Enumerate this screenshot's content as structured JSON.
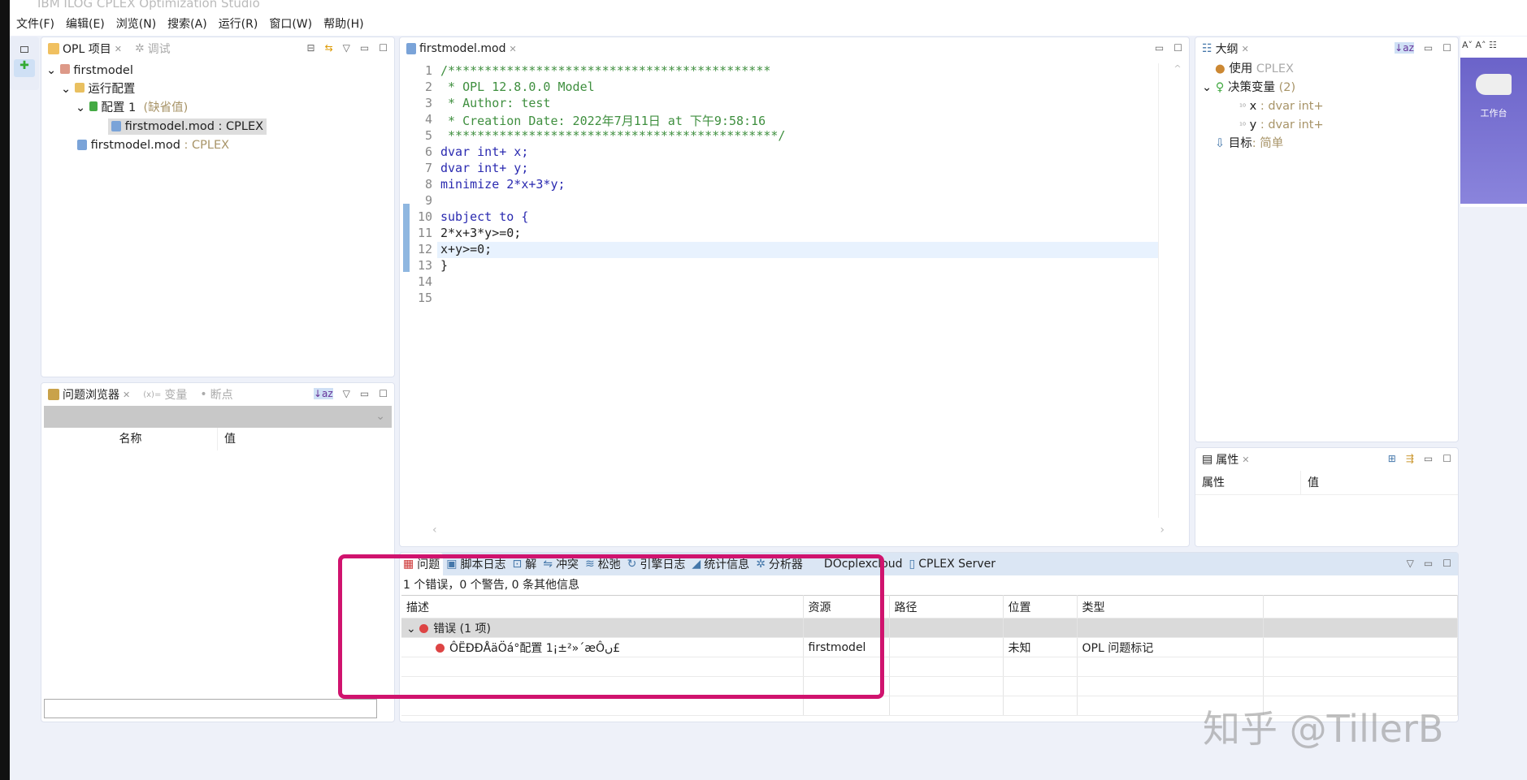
{
  "window": {
    "title": "IBM ILOG CPLEX Optimization Studio"
  },
  "menu": [
    "文件(F)",
    "编辑(E)",
    "浏览(N)",
    "搜索(A)",
    "运行(R)",
    "窗口(W)",
    "帮助(H)"
  ],
  "project_panel": {
    "tabs": [
      "OPL 项目",
      "调试"
    ],
    "tree": {
      "project": "firstmodel",
      "run_configs": "运行配置",
      "config": "配置 1",
      "config_default": "(缺省值)",
      "config_model": "firstmodel.mod : CPLEX",
      "model_name": "firstmodel.mod",
      "model_engine": ": CPLEX"
    }
  },
  "browser_panel": {
    "tabs": [
      "问题浏览器",
      "变量",
      "断点"
    ],
    "columns": [
      "名称",
      "值"
    ]
  },
  "editor": {
    "tab": "firstmodel.mod",
    "lines": [
      {
        "n": "1",
        "t": "/********************************************",
        "c": "cm"
      },
      {
        "n": "2",
        "t": " * OPL 12.8.0.0 Model",
        "c": "cm"
      },
      {
        "n": "3",
        "t": " * Author: test",
        "c": "cm"
      },
      {
        "n": "4",
        "t": " * Creation Date: 2022年7月11日 at 下午9:58:16",
        "c": "cm"
      },
      {
        "n": "5",
        "t": " *********************************************/",
        "c": "cm"
      },
      {
        "n": "6",
        "t": "dvar int+ x;",
        "c": "kw"
      },
      {
        "n": "7",
        "t": "dvar int+ y;",
        "c": "kw"
      },
      {
        "n": "8",
        "t": "minimize 2*x+3*y;",
        "c": "kw"
      },
      {
        "n": "9",
        "t": "",
        "c": ""
      },
      {
        "n": "10",
        "t": "subject to {",
        "c": "kw"
      },
      {
        "n": "11",
        "t": "2*x+3*y>=0;",
        "c": ""
      },
      {
        "n": "12",
        "t": "x+y>=0;",
        "c": ""
      },
      {
        "n": "13",
        "t": "}",
        "c": ""
      },
      {
        "n": "14",
        "t": "",
        "c": ""
      },
      {
        "n": "15",
        "t": "",
        "c": ""
      }
    ]
  },
  "outline": {
    "tab": "大纲",
    "use": "使用",
    "use_val": "CPLEX",
    "vars": "决策变量",
    "vars_count": "(2)",
    "x": "x",
    "x_type": ": dvar int+",
    "y": "y",
    "y_type": ": dvar int+",
    "goal": "目标",
    "goal_val": ": 简单"
  },
  "properties": {
    "tab": "属性",
    "columns": [
      "属性",
      "值"
    ]
  },
  "welcome": {
    "label": "工作台"
  },
  "problems": {
    "tabs": [
      "问题",
      "脚本日志",
      "解",
      "冲突",
      "松弛",
      "引擎日志",
      "统计信息",
      "分析器",
      "DOcplexcloud",
      "CPLEX Server"
    ],
    "summary": "1 个错误，0 个警告, 0 条其他信息",
    "columns": [
      "描述",
      "资源",
      "路径",
      "位置",
      "类型"
    ],
    "group": "错误 (1 项)",
    "row": {
      "desc": "ÔËÐÐÅäÖá°配置 1¡±²»´æÔں£",
      "resource": "firstmodel",
      "path": "",
      "location": "未知",
      "type": "OPL 问题标记"
    }
  },
  "watermark": "知乎 @TillerB",
  "colors": {
    "highlight": "#d0136e",
    "accent": "#5b5fc7"
  }
}
